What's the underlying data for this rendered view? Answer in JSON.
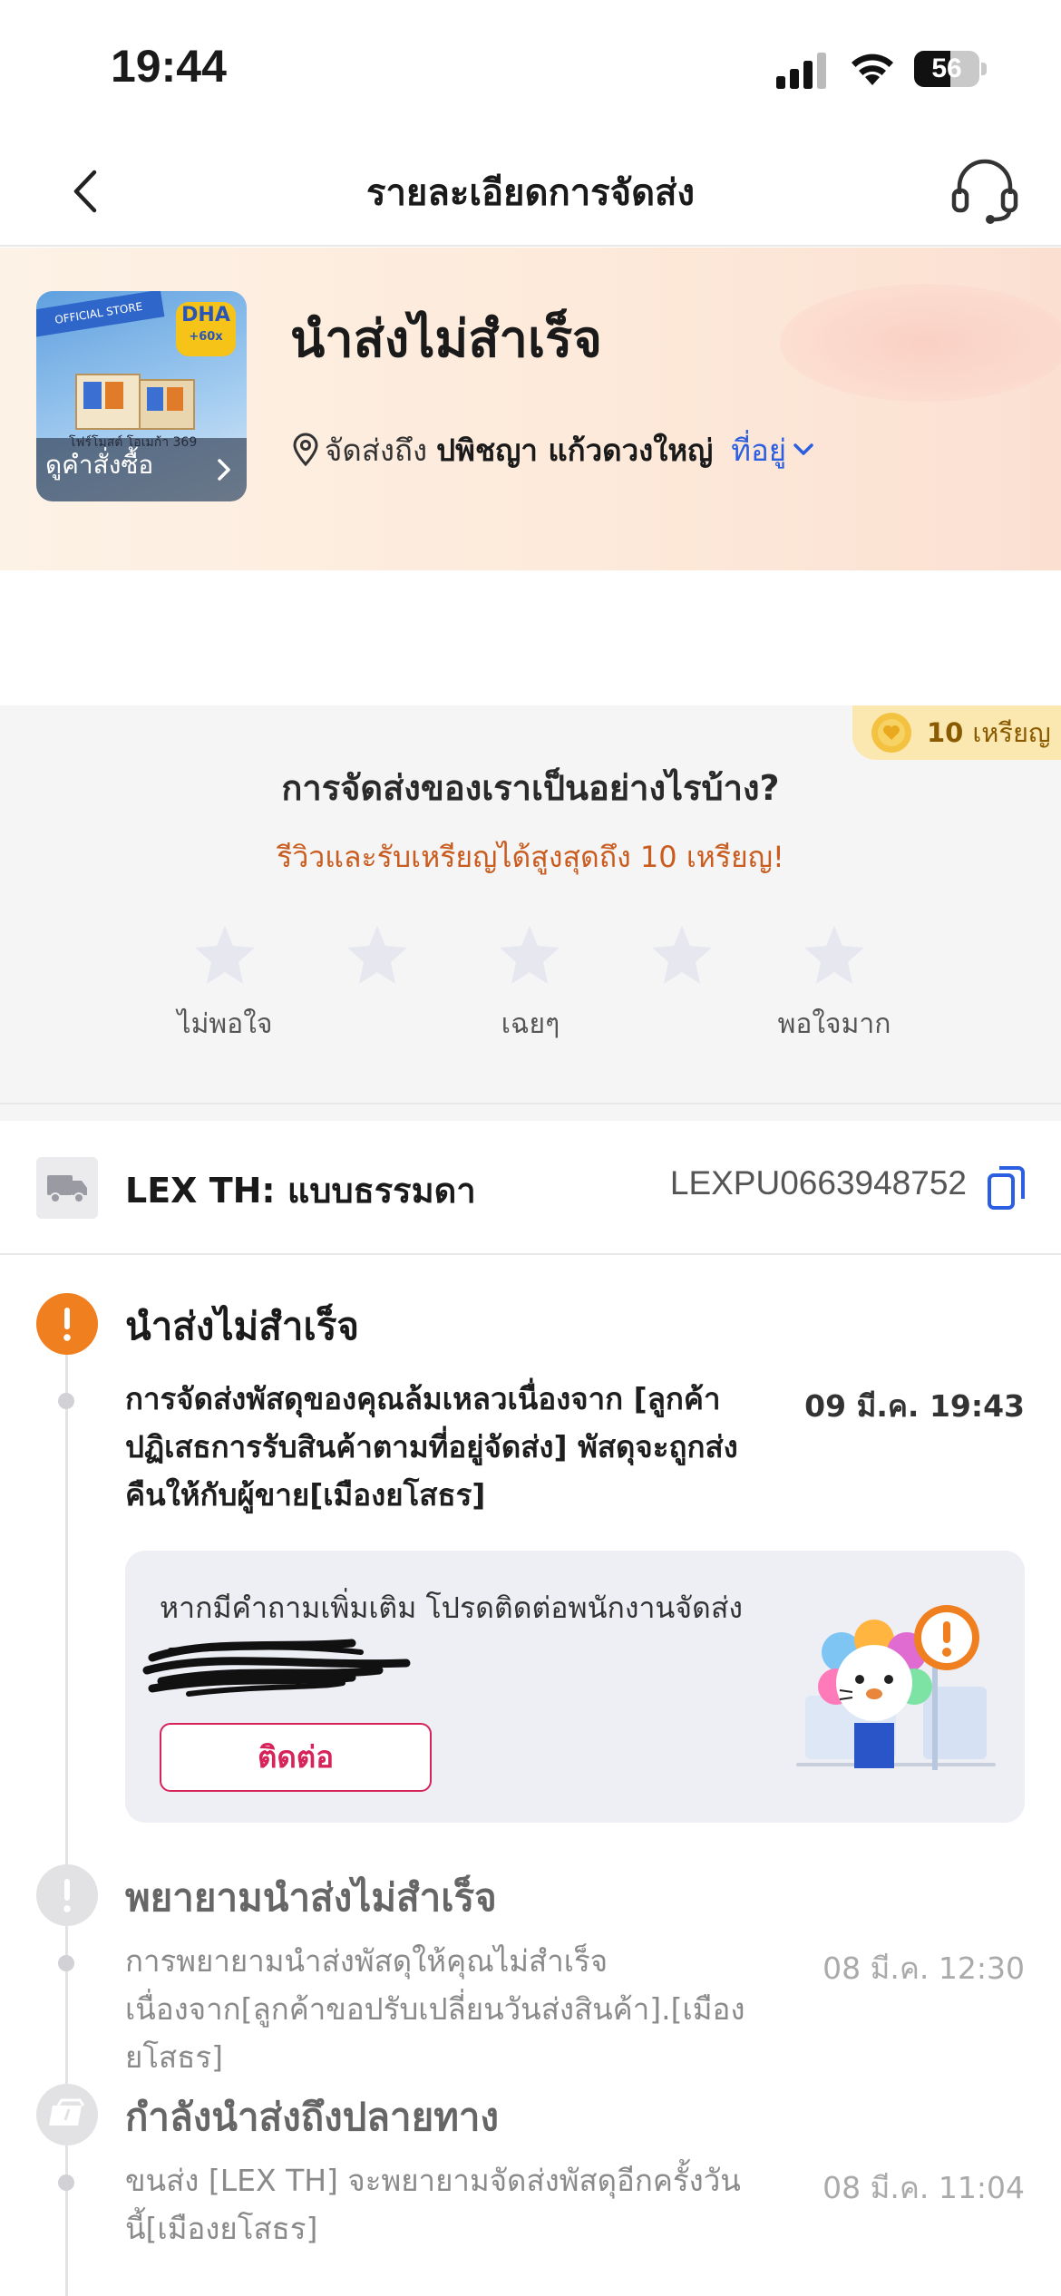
{
  "status_bar": {
    "time": "19:44",
    "battery": "56",
    "battery_level": 0.56
  },
  "header": {
    "title": "รายละเอียดการจัดส่ง",
    "back_icon": "chevron-left-icon",
    "support_icon": "headset-icon"
  },
  "hero": {
    "product_image_label": "ดูคำสั่งซื้อ",
    "product_text": "โฟร์โมสต์ โอเมก้า 369",
    "product_badge_top": "DHA",
    "product_badge_bottom": "+60x",
    "store_tag": "OFFICIAL STORE",
    "status": "นำส่งไม่สำเร็จ",
    "address_prefix": "จัดส่งถึง",
    "recipient": "ปพิชญา แก้วดวงใหญ่",
    "address_link": "ที่อยู่"
  },
  "rating": {
    "coins": "10",
    "coins_unit": "เหรียญ",
    "question": "การจัดส่งของเราเป็นอย่างไรบ้าง?",
    "promo": "รีวิวและรับเหรียญได้สูงสุดถึง 10 เหรียญ!",
    "stars": 5,
    "selected": 0,
    "labels": {
      "low": "ไม่พอใจ",
      "mid": "เฉยๆ",
      "high": "พอใจมาก"
    },
    "colors": {
      "star_empty": "#e7e8ef",
      "coin": "#f3c241"
    }
  },
  "courier": {
    "name": "LEX TH: แบบธรรมดา",
    "tracking_number": "LEXPU0663948752"
  },
  "timeline": {
    "events": [
      {
        "title": "นำส่งไม่สำเร็จ",
        "description": "การจัดส่งพัสดุของคุณล้มเหลวเนื่องจาก [ลูกค้าปฏิเสธการรับสินค้าตามที่อยู่จัดส่ง] พัสดุจะถูกส่งคืนให้กับผู้ขาย[เมืองยโสธร]",
        "time": "09 มี.ค. 19:43",
        "icon": "exclamation-icon"
      },
      {
        "title": "พยายามนำส่งไม่สำเร็จ",
        "description": "การพยายามนำส่งพัสดุให้คุณไม่สำเร็จเนื่องจาก[ลูกค้าขอปรับเปลี่ยนวันส่งสินค้า].[เมืองยโสธร]",
        "time": "08 มี.ค. 12:30",
        "icon": "exclamation-icon"
      },
      {
        "title": "กำลังนำส่งถึงปลายทาง",
        "description": "ขนส่ง [LEX TH] จะพยายามจัดส่งพัสดุอีกครั้งวันนี้[เมืองยโสธร]",
        "time": "08 มี.ค. 11:04",
        "icon": "package-icon"
      }
    ],
    "contact_card": {
      "text": "หากมีคำถามเพิ่มเติม โปรดติดต่อพนักงานจัดส่ง",
      "button": "ติดต่อ"
    }
  },
  "colors": {
    "accent_orange": "#f07f1f",
    "link_blue": "#2b5ee0",
    "contact_red": "#d6245a",
    "promo_orange": "#c95c1e"
  }
}
